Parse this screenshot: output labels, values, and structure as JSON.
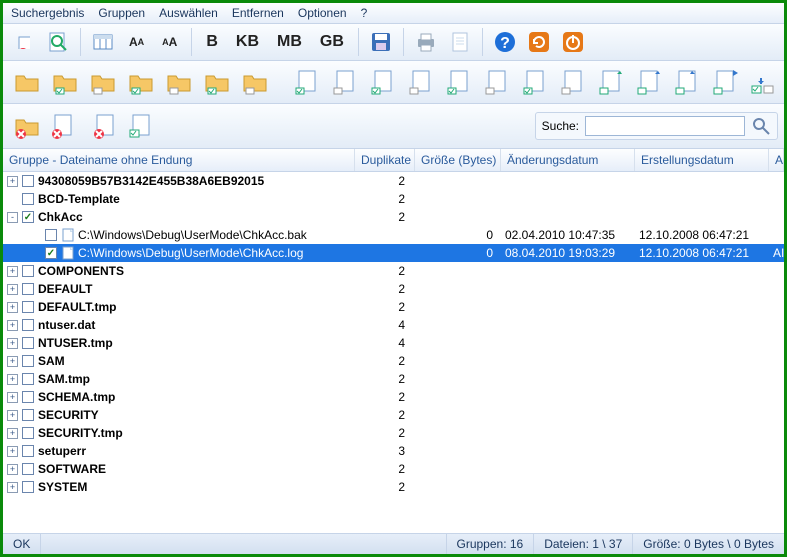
{
  "menu": {
    "items": [
      "Suchergebnis",
      "Gruppen",
      "Auswählen",
      "Entfernen",
      "Optionen",
      "?"
    ]
  },
  "toolbar1": {
    "btn_b": "B",
    "btn_kb": "KB",
    "btn_mb": "MB",
    "btn_gb": "GB"
  },
  "search": {
    "label": "Suche:",
    "value": ""
  },
  "columns": {
    "name": "Gruppe - Dateiname ohne Endung",
    "dup": "Duplikate",
    "size": "Größe (Bytes)",
    "mod": "Änderungsdatum",
    "cre": "Erstellungsdatum",
    "attr": "Attribute"
  },
  "rows": [
    {
      "type": "group",
      "expand": "+",
      "checked": false,
      "bold": true,
      "name": "94308059B57B3142E455B38A6EB92015",
      "dup": "2"
    },
    {
      "type": "group",
      "expand": "",
      "checked": false,
      "bold": true,
      "name": "BCD-Template",
      "dup": "2"
    },
    {
      "type": "group",
      "expand": "-",
      "checked": true,
      "bold": true,
      "name": "ChkAcc",
      "dup": "2"
    },
    {
      "type": "file",
      "indent": 28,
      "checked": false,
      "name": "C:\\Windows\\Debug\\UserMode\\ChkAcc.bak",
      "size": "0",
      "mod": "02.04.2010 10:47:35",
      "cre": "12.10.2008 06:47:21",
      "attr": ""
    },
    {
      "type": "file",
      "indent": 28,
      "checked": true,
      "selected": true,
      "name": "C:\\Windows\\Debug\\UserMode\\ChkAcc.log",
      "size": "0",
      "mod": "08.04.2010 19:03:29",
      "cre": "12.10.2008 06:47:21",
      "attr": "AI"
    },
    {
      "type": "group",
      "expand": "+",
      "checked": false,
      "bold": true,
      "name": "COMPONENTS",
      "dup": "2"
    },
    {
      "type": "group",
      "expand": "+",
      "checked": false,
      "bold": true,
      "name": "DEFAULT",
      "dup": "2"
    },
    {
      "type": "group",
      "expand": "+",
      "checked": false,
      "bold": true,
      "name": "DEFAULT.tmp",
      "dup": "2"
    },
    {
      "type": "group",
      "expand": "+",
      "checked": false,
      "bold": true,
      "name": "ntuser.dat",
      "dup": "4"
    },
    {
      "type": "group",
      "expand": "+",
      "checked": false,
      "bold": true,
      "name": "NTUSER.tmp",
      "dup": "4"
    },
    {
      "type": "group",
      "expand": "+",
      "checked": false,
      "bold": true,
      "name": "SAM",
      "dup": "2"
    },
    {
      "type": "group",
      "expand": "+",
      "checked": false,
      "bold": true,
      "name": "SAM.tmp",
      "dup": "2"
    },
    {
      "type": "group",
      "expand": "+",
      "checked": false,
      "bold": true,
      "name": "SCHEMA.tmp",
      "dup": "2"
    },
    {
      "type": "group",
      "expand": "+",
      "checked": false,
      "bold": true,
      "name": "SECURITY",
      "dup": "2"
    },
    {
      "type": "group",
      "expand": "+",
      "checked": false,
      "bold": true,
      "name": "SECURITY.tmp",
      "dup": "2"
    },
    {
      "type": "group",
      "expand": "+",
      "checked": false,
      "bold": true,
      "name": "setuperr",
      "dup": "3"
    },
    {
      "type": "group",
      "expand": "+",
      "checked": false,
      "bold": true,
      "name": "SOFTWARE",
      "dup": "2"
    },
    {
      "type": "group",
      "expand": "+",
      "checked": false,
      "bold": true,
      "name": "SYSTEM",
      "dup": "2"
    }
  ],
  "status": {
    "ok": "OK",
    "groups": "Gruppen: 16",
    "files": "Dateien: 1 \\ 37",
    "size": "Größe: 0 Bytes \\ 0 Bytes"
  }
}
